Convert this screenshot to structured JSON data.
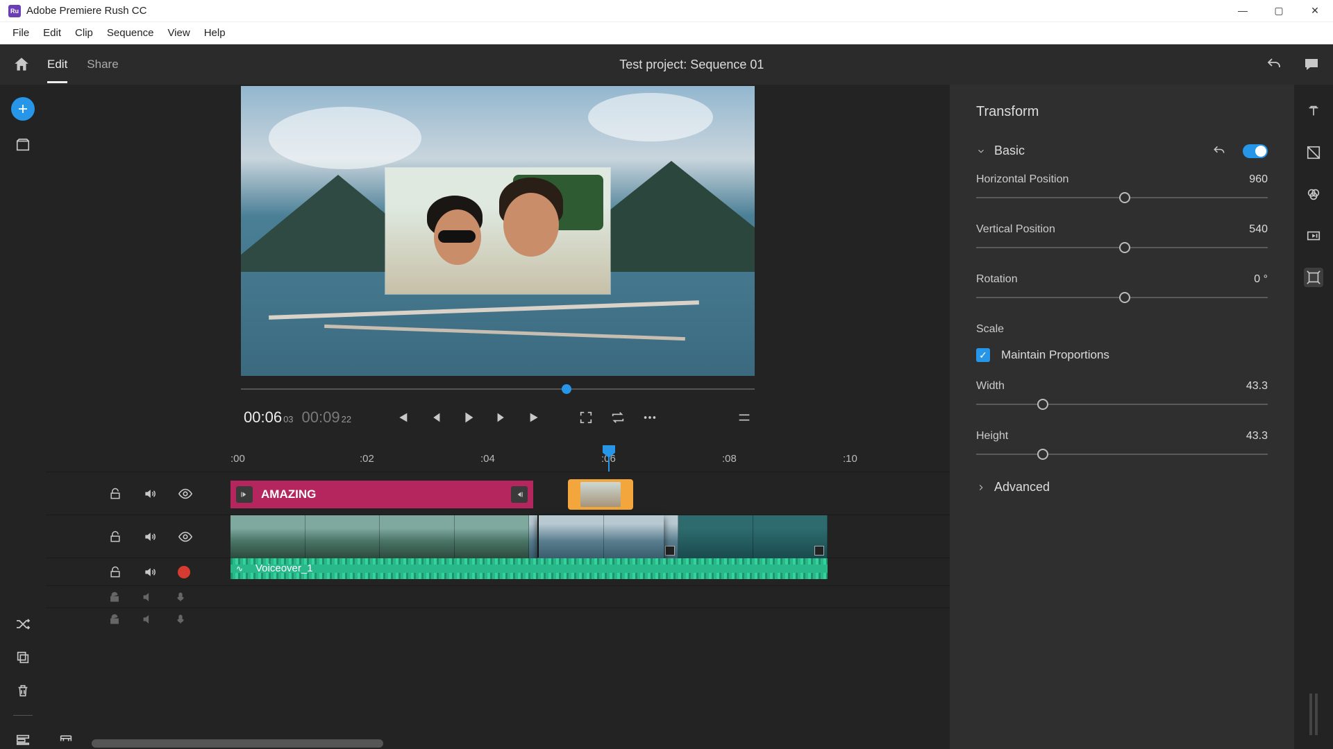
{
  "titlebar": {
    "app_name": "Adobe Premiere Rush CC"
  },
  "menubar": {
    "items": [
      "File",
      "Edit",
      "Clip",
      "Sequence",
      "View",
      "Help"
    ]
  },
  "header": {
    "tabs": [
      {
        "label": "Edit",
        "active": true
      },
      {
        "label": "Share",
        "active": false
      }
    ],
    "project_title": "Test project: Sequence 01"
  },
  "playback": {
    "current_time": "00:06",
    "current_frames": "03",
    "duration_time": "00:09",
    "duration_frames": "22"
  },
  "ruler": {
    "marks": [
      ":00",
      ":02",
      ":04",
      ":06",
      ":08",
      ":10"
    ]
  },
  "tracks": {
    "title_clip_label": "AMAZING",
    "audio_clip_label": "Voiceover_1"
  },
  "transform": {
    "panel_title": "Transform",
    "basic_label": "Basic",
    "horizontal_position": {
      "label": "Horizontal Position",
      "value": "960"
    },
    "vertical_position": {
      "label": "Vertical Position",
      "value": "540"
    },
    "rotation": {
      "label": "Rotation",
      "value": "0 °"
    },
    "scale_label": "Scale",
    "maintain_proportions_label": "Maintain Proportions",
    "width": {
      "label": "Width",
      "value": "43.3"
    },
    "height": {
      "label": "Height",
      "value": "43.3"
    },
    "advanced_label": "Advanced"
  }
}
